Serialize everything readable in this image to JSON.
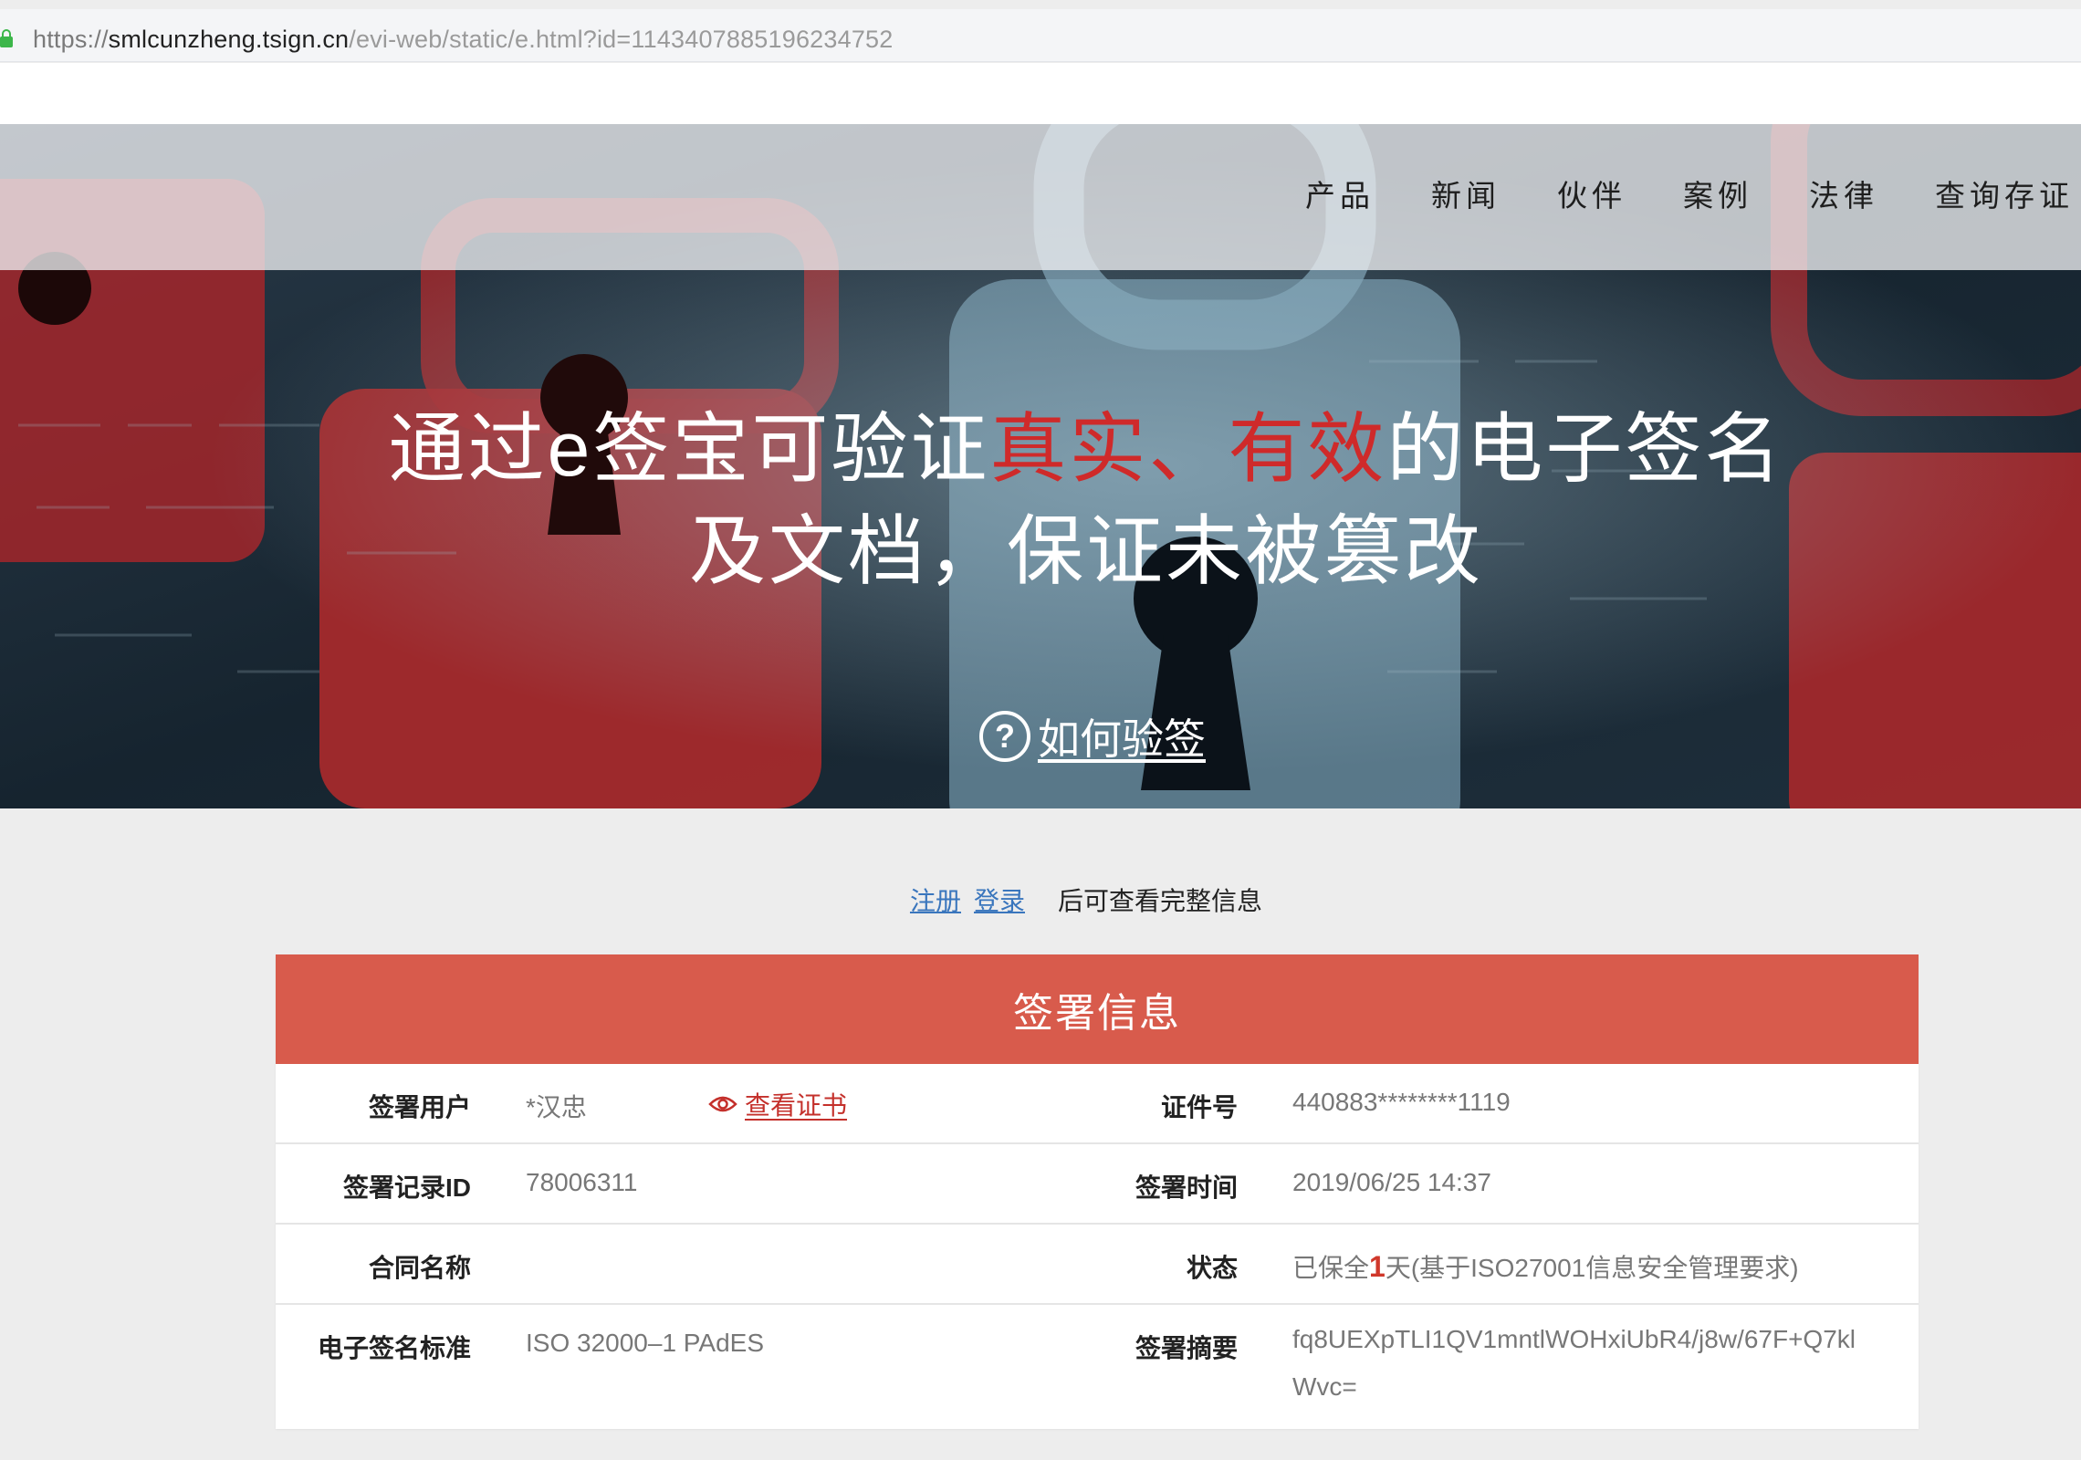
{
  "browser": {
    "url_protocol": "https://",
    "url_host": "smlcunzheng.tsign.cn",
    "url_path": "/evi-web/static/e.html?id=1143407885196234752"
  },
  "nav": {
    "items": [
      "产品",
      "新闻",
      "伙伴",
      "案例",
      "法律",
      "查询存证"
    ]
  },
  "hero": {
    "headline_part1": "通过e签宝可验证",
    "headline_highlight": "真实、有效",
    "headline_part2": "的电子签名",
    "headline_line2": "及文档，保证未被篡改",
    "howto_icon": "?",
    "howto_label": "如何验签",
    "highlight_color": "#cf2a2a"
  },
  "auth_hint": {
    "register": "注册",
    "login": "登录",
    "rest": "后可查看完整信息"
  },
  "card": {
    "title": "签署信息",
    "header_color": "#d85b4c",
    "rows": [
      {
        "left_label": "签署用户",
        "left_value": "*汉忠",
        "link": "查看证书",
        "right_label": "证件号",
        "right_value": "440883********1119"
      },
      {
        "left_label": "签署记录ID",
        "left_value": "78006311",
        "right_label": "签署时间",
        "right_value": "2019/06/25 14:37"
      },
      {
        "left_label": "合同名称",
        "left_value": "",
        "right_label": "状态",
        "status_prefix": "已保全",
        "status_days": "1",
        "status_suffix": "天(基于ISO27001信息安全管理要求)"
      },
      {
        "left_label": "电子签名标准",
        "left_value": "ISO 32000–1 PAdES",
        "right_label": "签署摘要",
        "right_value": "fq8UEXpTLI1QV1mntlWOHxiUbR4/j8w/67F+Q7klWvc="
      }
    ]
  }
}
